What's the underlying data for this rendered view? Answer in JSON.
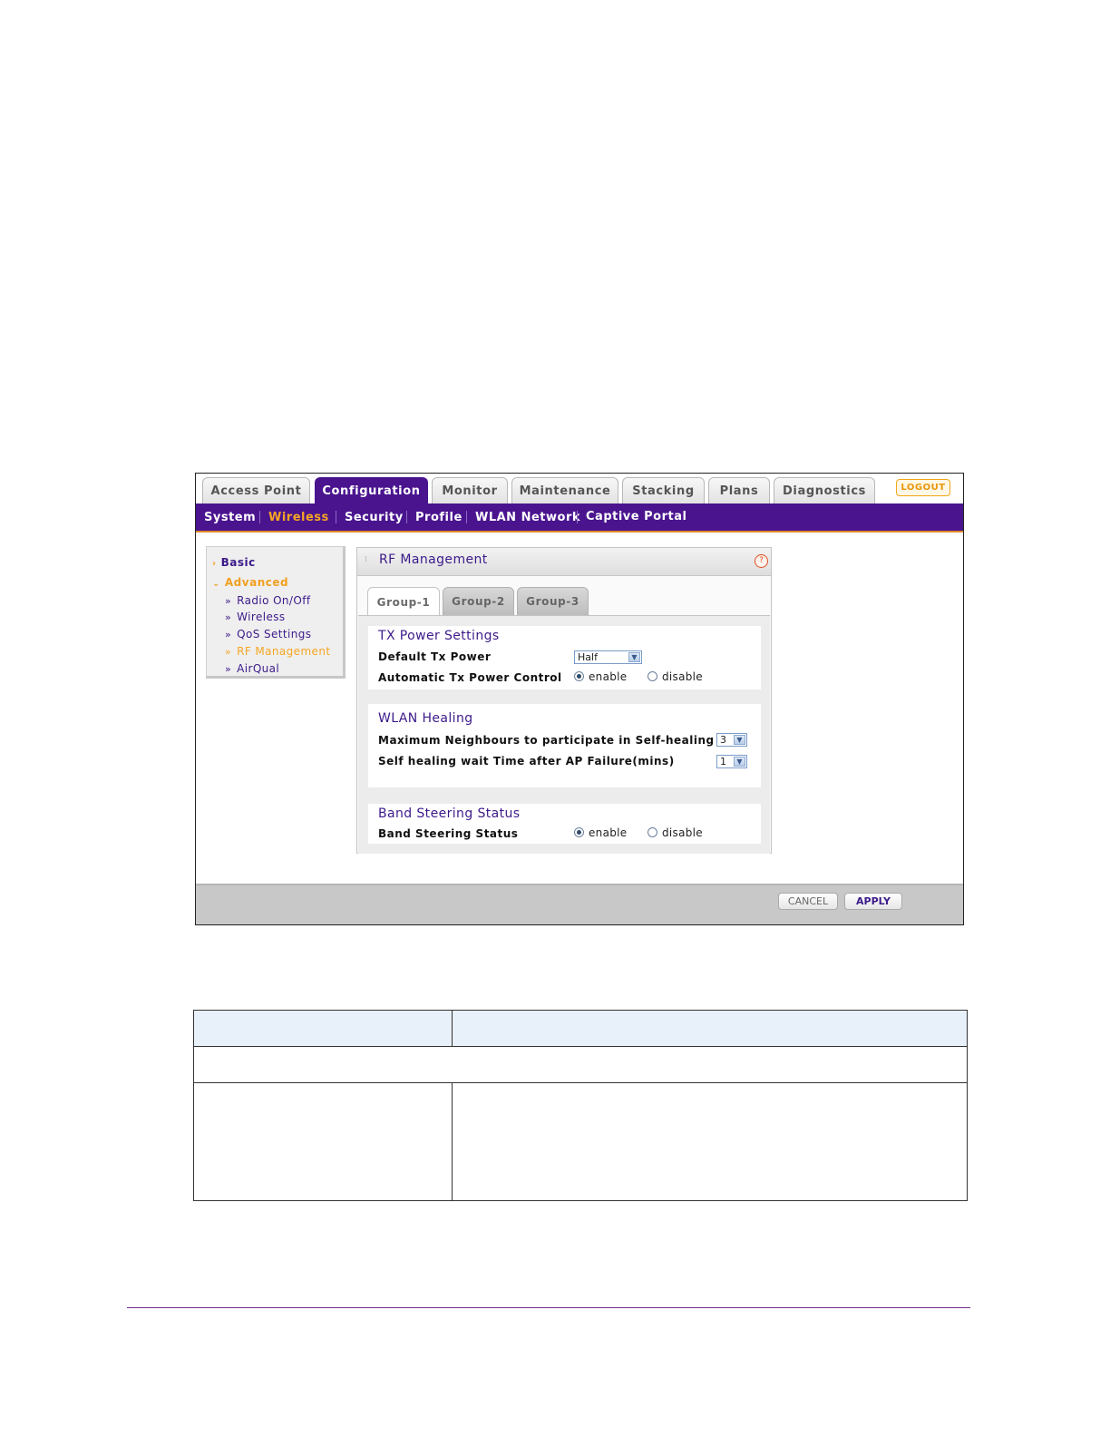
{
  "top_tabs": [
    "Access Point",
    "Configuration",
    "Monitor",
    "Maintenance",
    "Stacking",
    "Plans",
    "Diagnostics"
  ],
  "active_top_tab": "Configuration",
  "logout_label": "LOGOUT",
  "sub_nav": [
    "System",
    "Wireless",
    "Security",
    "Profile",
    "WLAN Network",
    "Captive Portal"
  ],
  "active_sub_nav": "Wireless",
  "left_menu": {
    "basic": "Basic",
    "advanced": "Advanced",
    "items": [
      "Radio On/Off",
      "Wireless",
      "QoS Settings",
      "RF Management",
      "AirQual"
    ],
    "active_item": "RF Management"
  },
  "panel": {
    "title": "RF Management",
    "help_icon": "?",
    "group_tabs": [
      "Group-1",
      "Group-2",
      "Group-3"
    ],
    "active_group_tab": "Group-1",
    "tx_power": {
      "title": "TX Power Settings",
      "default_label": "Default Tx Power",
      "default_value": "Half",
      "auto_label": "Automatic Tx Power Control",
      "enable_label": "enable",
      "disable_label": "disable",
      "selected": "enable"
    },
    "wlan_healing": {
      "title": "WLAN Healing",
      "max_neighbours_label": "Maximum Neighbours to participate in Self-healing",
      "max_neighbours_value": "3",
      "wait_time_label": "Self healing wait Time after AP Failure(mins)",
      "wait_time_value": "1"
    },
    "band_steering": {
      "title": "Band Steering Status",
      "label": "Band Steering Status",
      "enable_label": "enable",
      "disable_label": "disable",
      "selected": "enable"
    }
  },
  "actions": {
    "cancel": "CANCEL",
    "apply": "APPLY"
  },
  "colors": {
    "brand_purple": "#4a148f",
    "accent_orange": "#f5a623",
    "table_header_bg": "#e8f0fa",
    "footer_rule": "#6a2d8a"
  }
}
